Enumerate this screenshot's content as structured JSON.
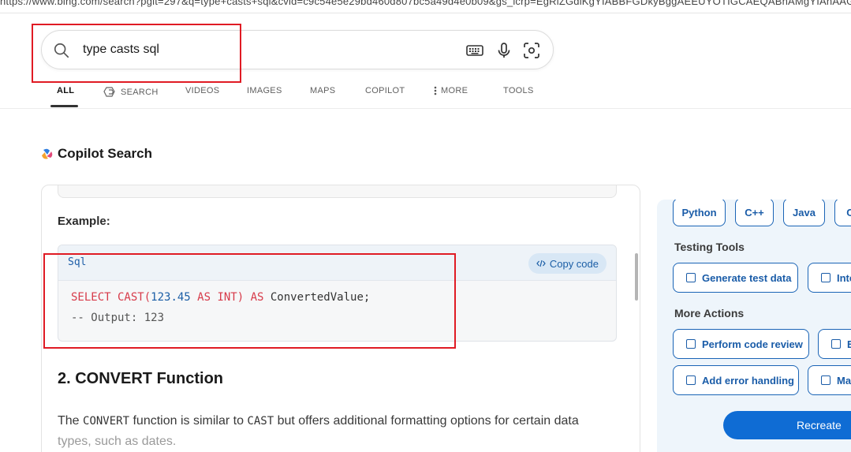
{
  "url": "https://www.bing.com/search?pglt=297&q=type+casts+sql&cvid=c9c54e5e29bd460d807bc5a49d4e0b09&gs_lcrp=EgRlZGdlKgYIABBFGDkyBggAEEUYOTIGCAEQABhAMgYIAhAAGEAy",
  "search": {
    "query": "type casts sql",
    "icons": [
      "search-icon",
      "keyboard-icon",
      "microphone-icon",
      "visual-search-icon"
    ]
  },
  "nav": {
    "tabs": [
      {
        "label": "ALL",
        "active": true
      },
      {
        "label": "SEARCH",
        "icon": "copilot-search-icon"
      },
      {
        "label": "VIDEOS"
      },
      {
        "label": "IMAGES"
      },
      {
        "label": "MAPS"
      },
      {
        "label": "COPILOT"
      },
      {
        "label": "MORE",
        "icon": "more-dots-icon"
      },
      {
        "label": "TOOLS"
      }
    ]
  },
  "copilot": {
    "title": "Copilot Search",
    "example_label": "Example:",
    "code": {
      "language": "Sql",
      "copy_label": "Copy code",
      "line1": {
        "t1": "SELECT CAST(",
        "t2": "123.45",
        "t3": " AS INT) ",
        "t4": "AS",
        "t5": " ConvertedValue;"
      },
      "line2": "-- Output: 123"
    },
    "section_title": "2. CONVERT Function",
    "paragraph": {
      "p1": "The ",
      "c1": "CONVERT",
      "p2": " function is similar to ",
      "c2": "CAST",
      "p3": " but offers additional formatting options for certain data",
      "p4": "types, such as dates."
    }
  },
  "side_panel": {
    "languages": [
      "Python",
      "C++",
      "Java",
      "C"
    ],
    "testing_tools_title": "Testing Tools",
    "testing_tools": [
      "Generate test data",
      "Inte"
    ],
    "more_actions_title": "More Actions",
    "more_actions": [
      "Perform code review",
      "E",
      "Add error handling",
      "Ma"
    ],
    "recreate_label": "Recreate"
  },
  "colors": {
    "accent_blue": "#1a64b6",
    "recreate_button": "#0f6cd4",
    "highlight_box": "#e01b24",
    "sql_keyword": "#d73a49",
    "sql_number": "#1b5ea6"
  }
}
